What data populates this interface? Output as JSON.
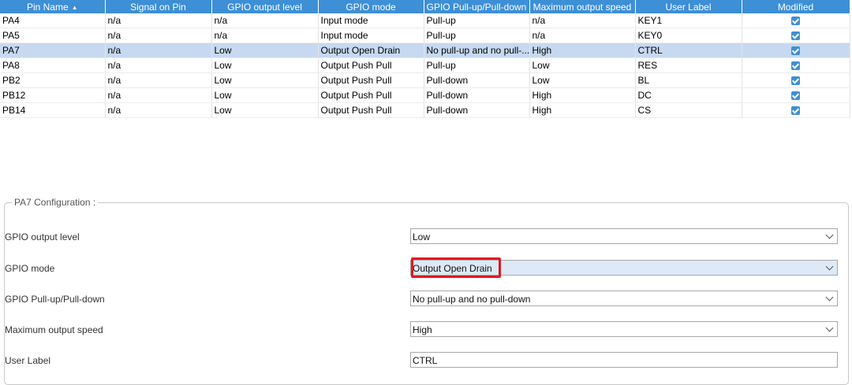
{
  "table": {
    "headers": [
      "Pin Name",
      "Signal on Pin",
      "GPIO output level",
      "GPIO mode",
      "GPIO Pull-up/Pull-down",
      "Maximum output speed",
      "User Label",
      "Modified"
    ],
    "sort_indicator": "▲",
    "rows": [
      {
        "pin": "PA4",
        "signal": "n/a",
        "level": "n/a",
        "mode": "Input mode",
        "pull": "Pull-up",
        "speed": "n/a",
        "label": "KEY1",
        "modified": true
      },
      {
        "pin": "PA5",
        "signal": "n/a",
        "level": "n/a",
        "mode": "Input mode",
        "pull": "Pull-up",
        "speed": "n/a",
        "label": "KEY0",
        "modified": true
      },
      {
        "pin": "PA7",
        "signal": "n/a",
        "level": "Low",
        "mode": "Output Open Drain",
        "pull": "No pull-up and no pull-...",
        "speed": "High",
        "label": "CTRL",
        "modified": true
      },
      {
        "pin": "PA8",
        "signal": "n/a",
        "level": "Low",
        "mode": "Output Push Pull",
        "pull": "Pull-up",
        "speed": "Low",
        "label": "RES",
        "modified": true
      },
      {
        "pin": "PB2",
        "signal": "n/a",
        "level": "Low",
        "mode": "Output Push Pull",
        "pull": "Pull-down",
        "speed": "Low",
        "label": "BL",
        "modified": true
      },
      {
        "pin": "PB12",
        "signal": "n/a",
        "level": "Low",
        "mode": "Output Push Pull",
        "pull": "Pull-down",
        "speed": "High",
        "label": "DC",
        "modified": true
      },
      {
        "pin": "PB14",
        "signal": "n/a",
        "level": "Low",
        "mode": "Output Push Pull",
        "pull": "Pull-down",
        "speed": "High",
        "label": "CS",
        "modified": true
      }
    ],
    "selected_row": 2
  },
  "config": {
    "title": "PA7 Configuration :",
    "fields": [
      {
        "label": "GPIO output level",
        "value": "Low"
      },
      {
        "label": "GPIO mode",
        "value": "Output Open Drain"
      },
      {
        "label": "GPIO Pull-up/Pull-down",
        "value": "No pull-up and no pull-down"
      },
      {
        "label": "Maximum output speed",
        "value": "High"
      },
      {
        "label": "User Label",
        "value": "CTRL"
      }
    ]
  },
  "colors": {
    "header_bg": "#3d8fd6",
    "selected_row_bg": "#c6d9f1",
    "highlight_border": "#e0191d"
  }
}
